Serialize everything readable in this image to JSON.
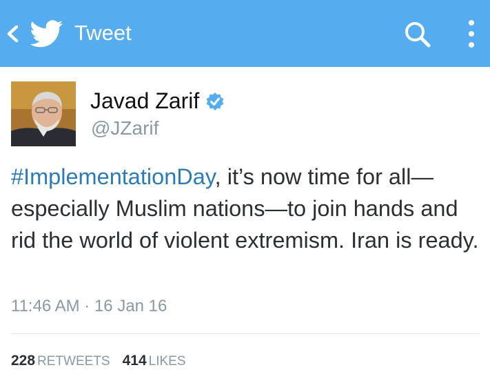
{
  "colors": {
    "header_bg": "#55acee",
    "hashtag": "#2b7bb9",
    "verified": "#55acee",
    "muted": "#8899a6"
  },
  "header": {
    "title": "Tweet",
    "icons": [
      "back-icon",
      "twitter-bird-icon",
      "search-icon",
      "more-icon"
    ]
  },
  "tweet": {
    "author_name": "Javad Zarif",
    "author_handle": "@JZarif",
    "verified": true,
    "hashtag": "#ImplementationDay",
    "text_body": ", it’s now time for all—especially Muslim nations—to join hands and rid the world of violent extremism. Iran is ready.",
    "timestamp": "11:46 AM · 16 Jan 16"
  },
  "stats": {
    "retweets_count": "228",
    "retweets_label": "RETWEETS",
    "likes_count": "414",
    "likes_label": "LIKES"
  }
}
